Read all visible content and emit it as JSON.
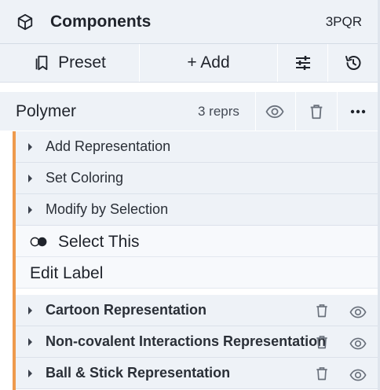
{
  "header": {
    "title": "Components",
    "pdb_id": "3PQR",
    "icon": "cube-icon"
  },
  "toolbar": {
    "preset_label": "Preset",
    "add_label": "+ Add",
    "options_icon": "sliders-icon",
    "history_icon": "history-icon"
  },
  "polymer": {
    "name": "Polymer",
    "repr_count": "3 reprs"
  },
  "actions": [
    {
      "label": "Add Representation"
    },
    {
      "label": "Set Coloring"
    },
    {
      "label": "Modify by Selection"
    }
  ],
  "select_this": "Select This",
  "edit_label": "Edit Label",
  "representations": [
    {
      "label": "Cartoon Representation"
    },
    {
      "label": "Non-covalent Interactions Representation"
    },
    {
      "label": "Ball & Stick Representation"
    }
  ],
  "colors": {
    "accent": "#ee9a4d",
    "header_bg": "#eef2f7"
  }
}
